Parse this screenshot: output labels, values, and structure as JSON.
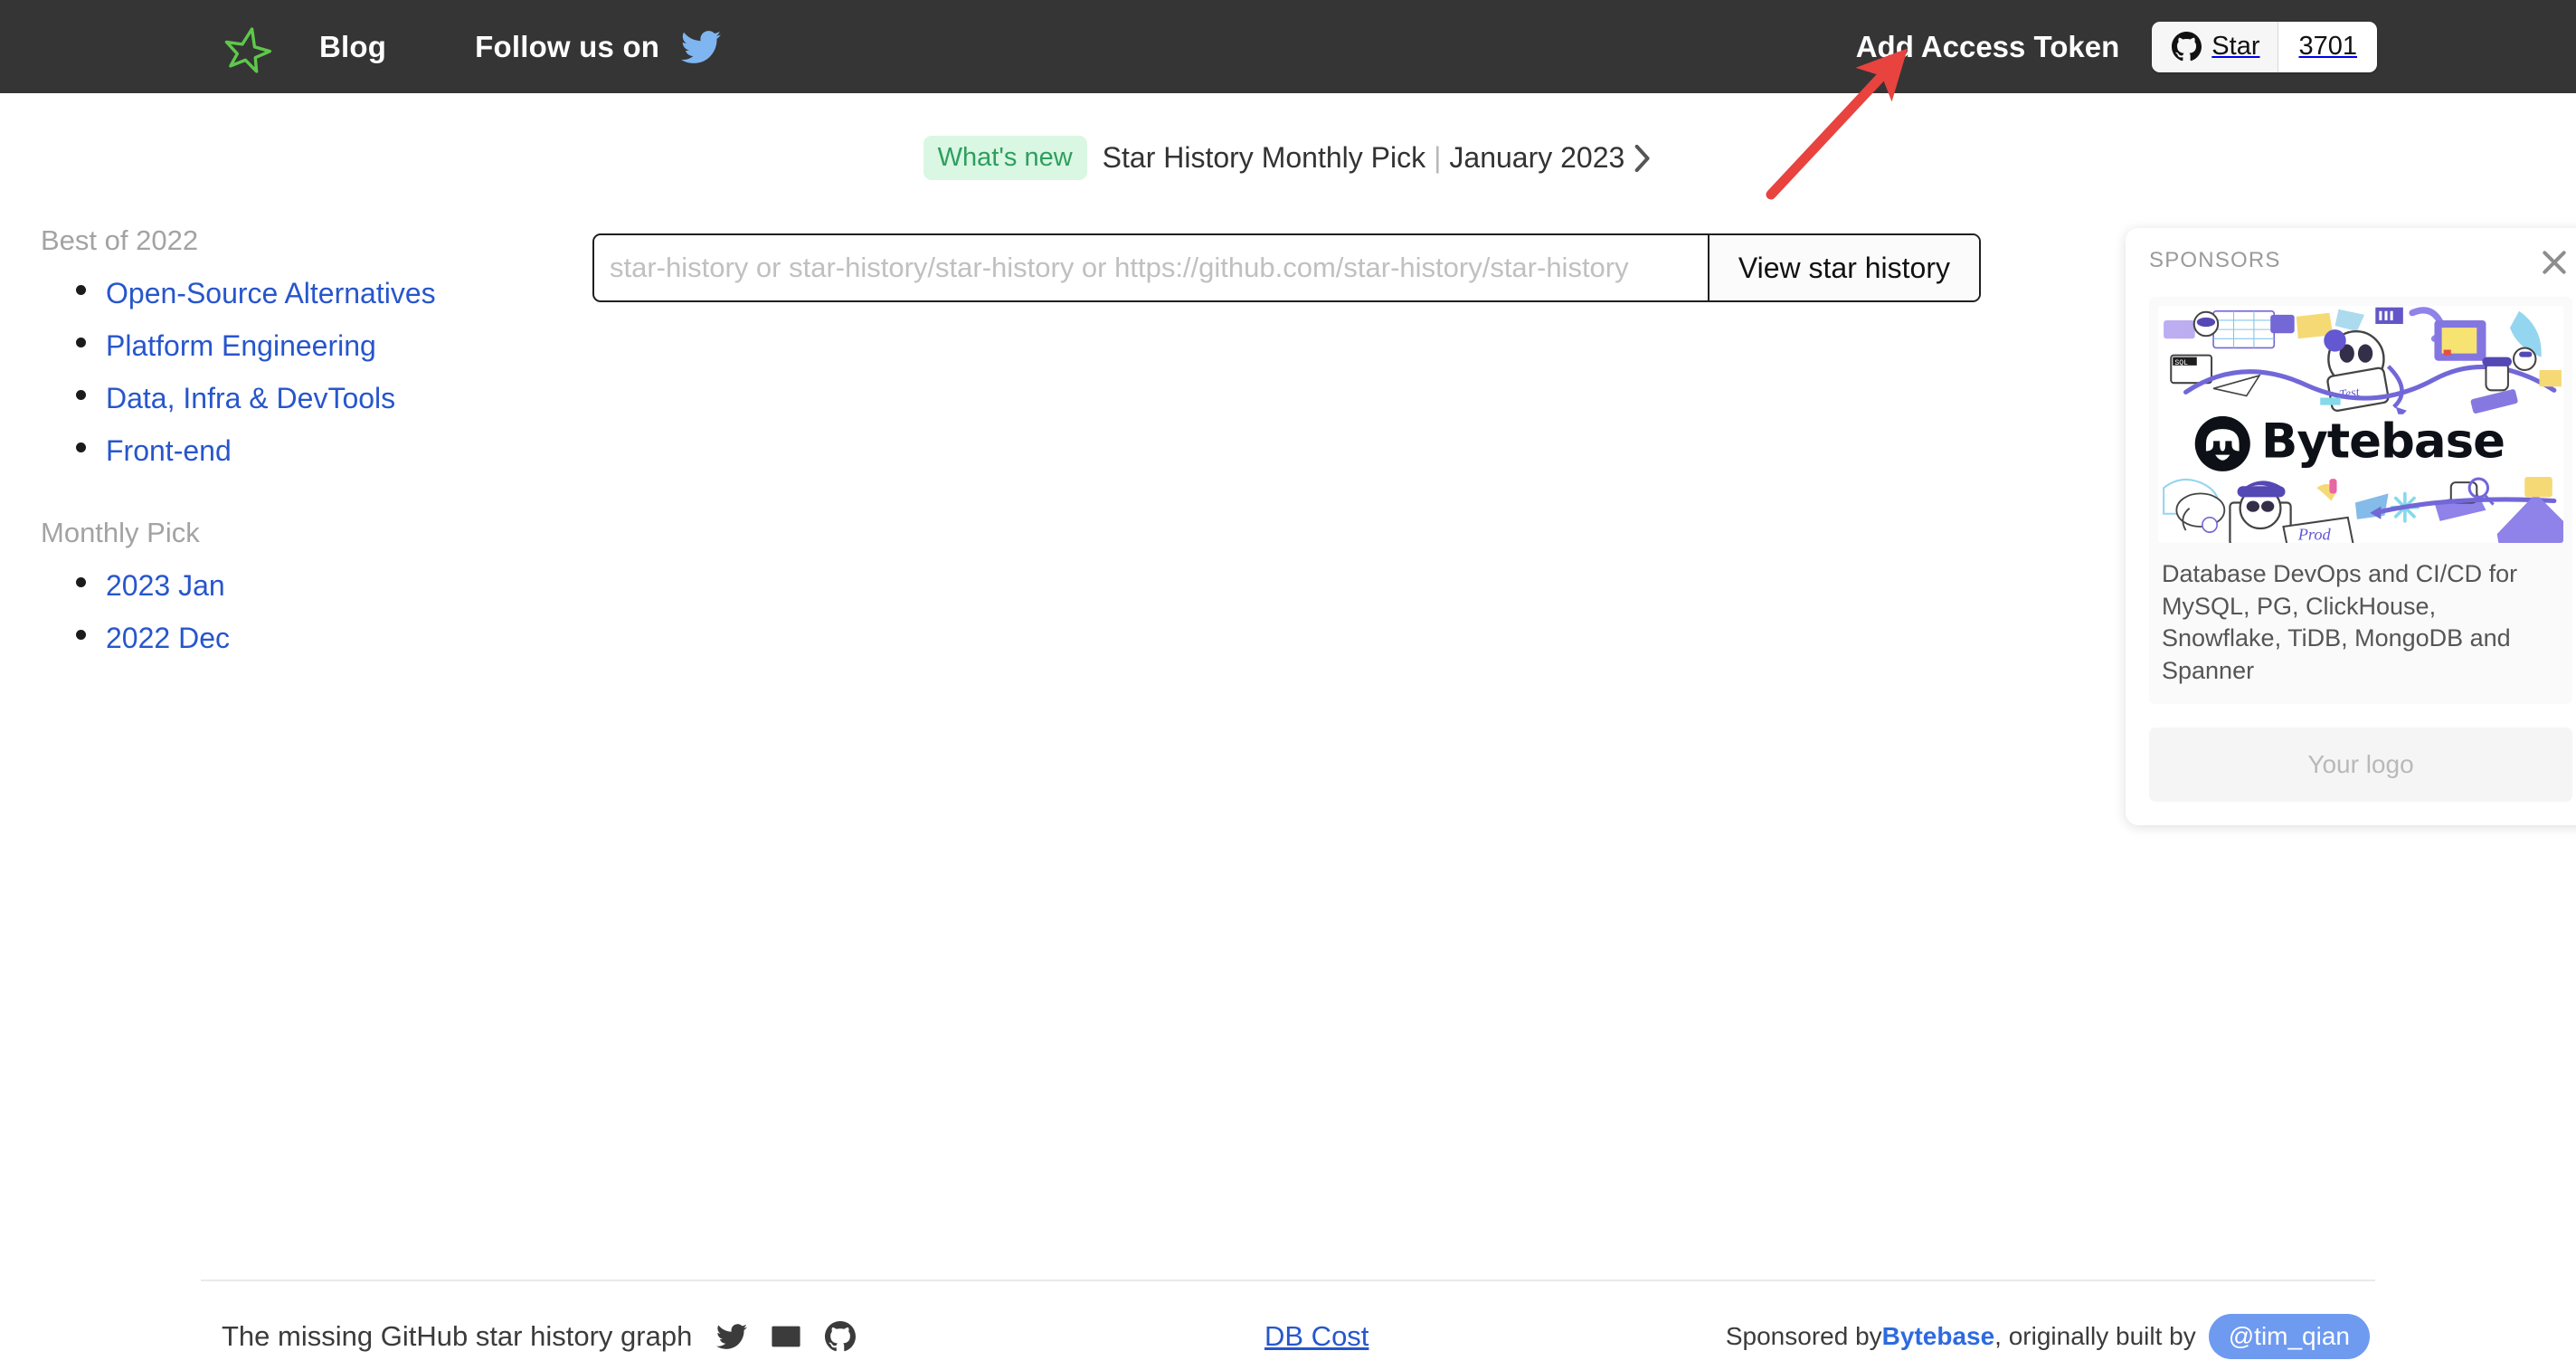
{
  "header": {
    "logo_icon": "star-logo-icon",
    "blog_label": "Blog",
    "follow_label": "Follow us on",
    "twitter_icon": "twitter-icon",
    "add_token_label": "Add Access Token",
    "github_star": {
      "icon": "github-octocat-icon",
      "label": "Star",
      "count": "3701"
    },
    "colors": {
      "background": "#353535",
      "logo_green": "#5ec84a",
      "twitter_blue": "#7fb5f0"
    }
  },
  "banner": {
    "badge_label": "What's new",
    "title": "Star History Monthly Pick",
    "separator": "|",
    "date": "January 2023",
    "chevron_icon": "chevron-right-icon",
    "badge_bg": "#d9f7e3",
    "badge_fg": "#2f9e5e"
  },
  "sidebar": {
    "sections": [
      {
        "heading": "Best of 2022",
        "items": [
          {
            "label": "Open-Source Alternatives"
          },
          {
            "label": "Platform Engineering"
          },
          {
            "label": "Data, Infra & DevTools"
          },
          {
            "label": "Front-end"
          }
        ]
      },
      {
        "heading": "Monthly Pick",
        "items": [
          {
            "label": "2023 Jan"
          },
          {
            "label": "2022 Dec"
          }
        ]
      }
    ],
    "link_color": "#2756cc"
  },
  "search": {
    "value": "",
    "placeholder": "star-history or star-history/star-history or https://github.com/star-history/star-history",
    "button_label": "View star history"
  },
  "sponsors": {
    "title": "SPONSORS",
    "close_icon": "close-icon",
    "banner_alt": "bytebase-banner-image",
    "brand_name": "Bytebase",
    "description": "Database DevOps and CI/CD for MySQL, PG, ClickHouse, Snowflake, TiDB, MongoDB and Spanner",
    "your_logo_label": "Your logo"
  },
  "annotation": {
    "arrow_color": "#e8433f",
    "points_to": "Add Access Token"
  },
  "footer": {
    "tagline": "The missing GitHub star history graph",
    "icons": [
      {
        "name": "twitter-icon"
      },
      {
        "name": "email-icon"
      },
      {
        "name": "github-icon"
      }
    ],
    "db_cost_label": "DB Cost",
    "sponsored_prefix": "Sponsored by ",
    "sponsor_name": "Bytebase",
    "built_by_text": ", originally built by ",
    "author_handle": "@tim_qian"
  }
}
